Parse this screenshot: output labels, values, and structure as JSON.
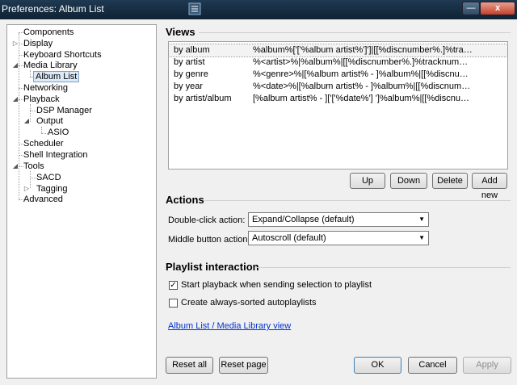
{
  "window": {
    "title": "Preferences: Album List",
    "min_glyph": "—",
    "close_glyph": "x"
  },
  "tree": {
    "items": [
      {
        "label": "Components"
      },
      {
        "label": "Display"
      },
      {
        "label": "Keyboard Shortcuts"
      },
      {
        "label": "Media Library"
      },
      {
        "label": "Album List"
      },
      {
        "label": "Networking"
      },
      {
        "label": "Playback"
      },
      {
        "label": "DSP Manager"
      },
      {
        "label": "Output"
      },
      {
        "label": "ASIO"
      },
      {
        "label": "Scheduler"
      },
      {
        "label": "Shell Integration"
      },
      {
        "label": "Tools"
      },
      {
        "label": "SACD"
      },
      {
        "label": "Tagging"
      },
      {
        "label": "Advanced"
      }
    ]
  },
  "views": {
    "title": "Views",
    "rows": [
      {
        "name": "by album",
        "pattern": "%album%['['%album artist%']']|[[%discnumber%.]%tracknumber%. ][%track artist% - ]%title%"
      },
      {
        "name": "by artist",
        "pattern": "%<artist>%|%album%|[[%discnumber%.]%tracknumber%. ]%title%"
      },
      {
        "name": "by genre",
        "pattern": "%<genre>%|[%album artist% - ]%album%|[[%discnumber%.]%tracknumber%. ]%title%"
      },
      {
        "name": "by year",
        "pattern": "%<date>%|[%album artist% - ]%album%|[[%discnumber%.]%tracknumber%. ]%title%"
      },
      {
        "name": "by artist/album",
        "pattern": "[%album artist% - ]['['%date%'] ']%album%|[[%discnumber%.]%tracknumber%. ]%title%"
      }
    ],
    "buttons": {
      "up": "Up",
      "down": "Down",
      "delete": "Delete",
      "add_new": "Add new"
    }
  },
  "actions": {
    "title": "Actions",
    "double_click_label": "Double-click action:",
    "double_click_value": "Expand/Collapse (default)",
    "middle_label": "Middle button action:",
    "middle_value": "Autoscroll (default)"
  },
  "playlist": {
    "title": "Playlist interaction",
    "start_playback_label": "Start playback when sending selection to playlist",
    "start_playback_checked": true,
    "always_sorted_label": "Create always-sorted autoplaylists",
    "always_sorted_checked": false,
    "link": "Album List / Media Library view",
    "check_glyph": "✓"
  },
  "footer": {
    "reset_all": "Reset all",
    "reset_page": "Reset page",
    "ok": "OK",
    "cancel": "Cancel",
    "apply": "Apply"
  }
}
